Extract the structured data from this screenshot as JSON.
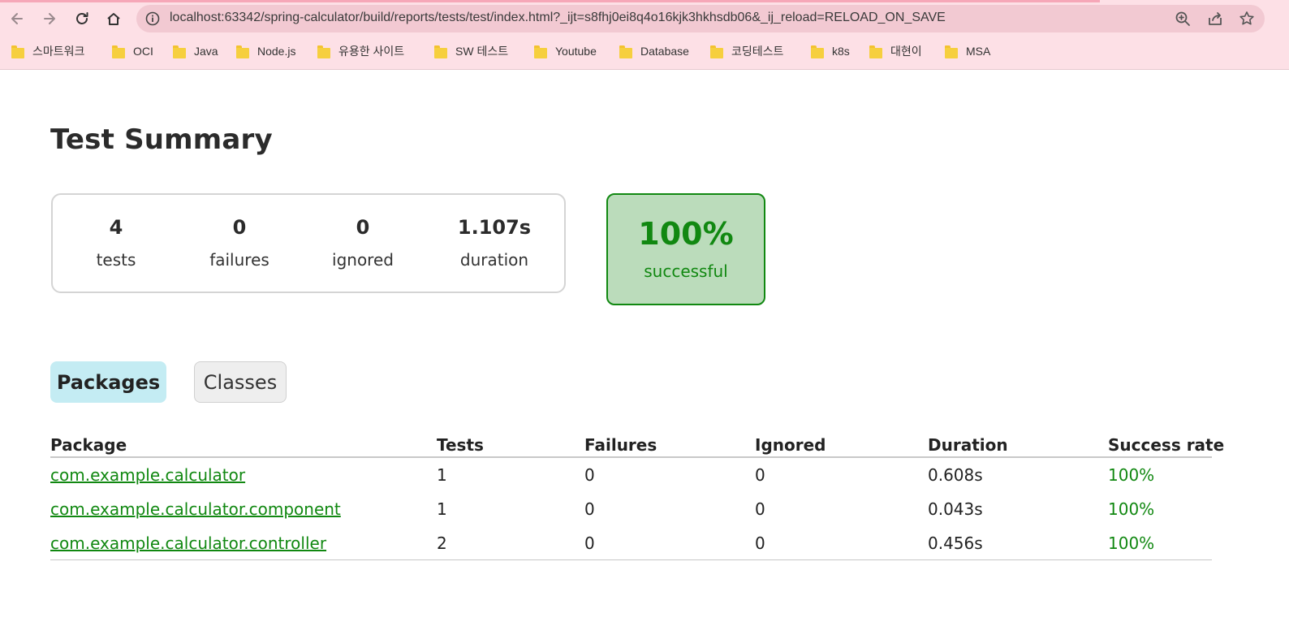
{
  "browser": {
    "url": "localhost:63342/spring-calculator/build/reports/tests/test/index.html?_ijt=s8fhj0ei8q4o16kjk3hkhsdb06&_ij_reload=RELOAD_ON_SAVE",
    "icons": [
      "back-icon",
      "forward-icon",
      "reload-icon",
      "home-icon",
      "info-icon",
      "zoom-icon",
      "share-icon",
      "star-icon"
    ],
    "bookmarks": [
      "스마트워크",
      "OCI",
      "Java",
      "Node.js",
      "유용한 사이트",
      "SW 테스트",
      "Youtube",
      "Database",
      "코딩테스트",
      "k8s",
      "대현이",
      "MSA"
    ]
  },
  "report": {
    "title": "Test Summary",
    "counters": [
      {
        "value": "4",
        "label": "tests"
      },
      {
        "value": "0",
        "label": "failures"
      },
      {
        "value": "0",
        "label": "ignored"
      },
      {
        "value": "1.107s",
        "label": "duration"
      }
    ],
    "success_rate": {
      "value": "100%",
      "label": "successful"
    },
    "tabs": [
      "Packages",
      "Classes"
    ],
    "table": {
      "headers": [
        "Package",
        "Tests",
        "Failures",
        "Ignored",
        "Duration",
        "Success rate"
      ],
      "rows": [
        [
          "com.example.calculator",
          "1",
          "0",
          "0",
          "0.608s",
          "100%"
        ],
        [
          "com.example.calculator.component",
          "1",
          "0",
          "0",
          "0.043s",
          "100%"
        ],
        [
          "com.example.calculator.controller",
          "2",
          "0",
          "0",
          "0.456s",
          "100%"
        ]
      ]
    }
  },
  "colors": {
    "chrome_bg": "#fde0e6",
    "success_green": "#118811",
    "success_bg": "#bbdcbb",
    "active_tab_bg": "#c4ecf3"
  }
}
